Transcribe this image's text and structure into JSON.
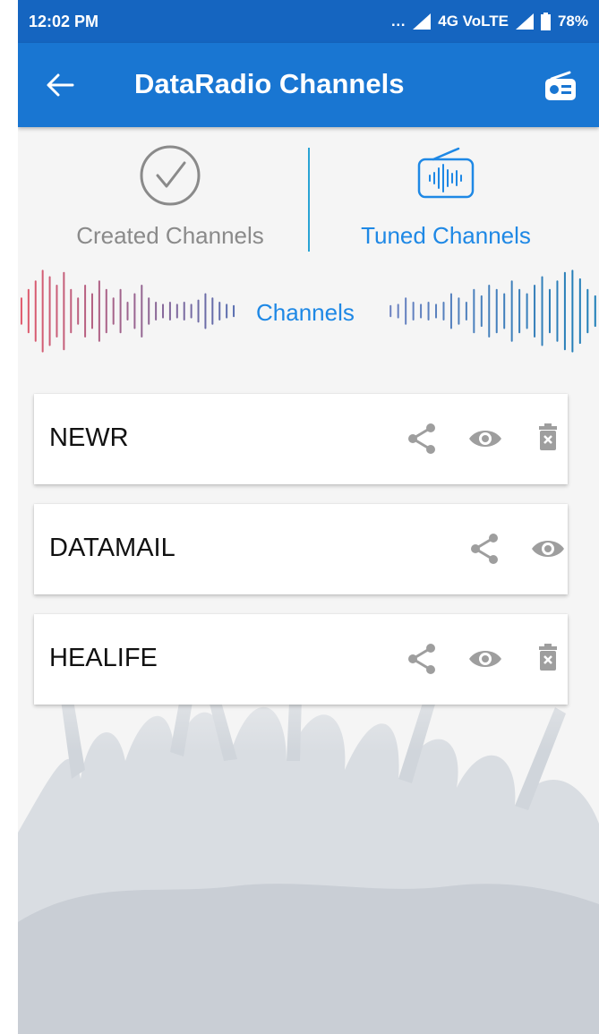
{
  "status_bar": {
    "time": "12:02 PM",
    "network": "4G VoLTE",
    "battery": "78%"
  },
  "app_bar": {
    "title": "DataRadio Channels",
    "back_icon": "arrow-back-icon",
    "action_icon": "radio-icon"
  },
  "tabs": [
    {
      "label": "Created Channels",
      "icon": "check-circle-icon",
      "active": false
    },
    {
      "label": "Tuned Channels",
      "icon": "radio-wave-icon",
      "active": true
    }
  ],
  "section_heading": "Channels",
  "channels": [
    {
      "name": "NEWR",
      "actions": [
        "share",
        "view",
        "delete"
      ]
    },
    {
      "name": "DATAMAIL",
      "actions": [
        "share",
        "view"
      ]
    },
    {
      "name": "HEALIFE",
      "actions": [
        "share",
        "view",
        "delete"
      ]
    }
  ],
  "colors": {
    "app_bar": "#1976d2",
    "status_bar": "#1565c0",
    "accent": "#1e88e5",
    "inactive": "#8a8a8a",
    "icon_gray": "#9e9e9e"
  }
}
